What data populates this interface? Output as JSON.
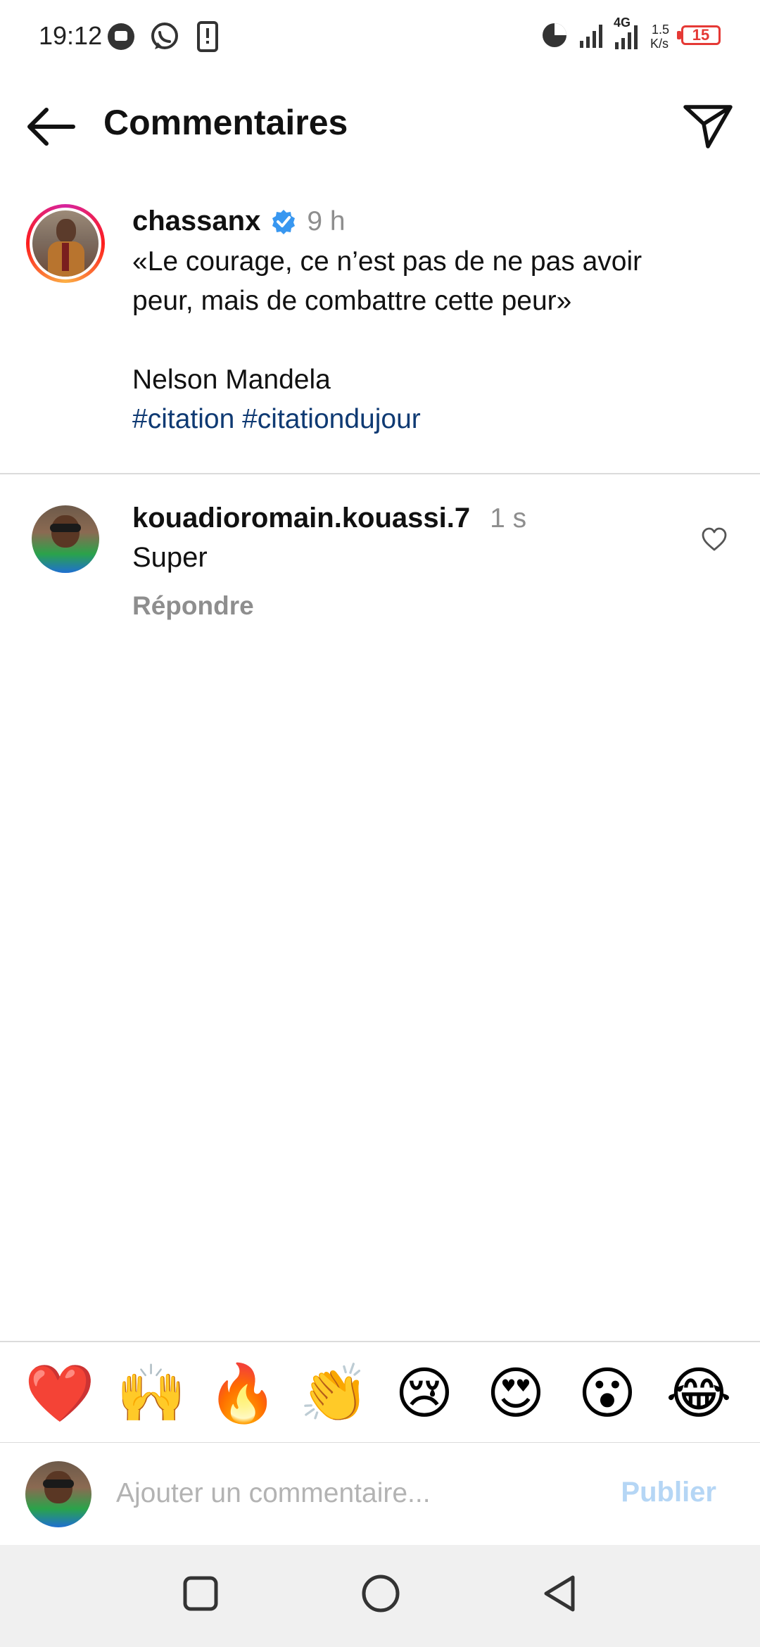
{
  "status_bar": {
    "time": "19:12",
    "network": "4G",
    "speed_top": "1.5",
    "speed_bottom": "K/s",
    "battery": "15"
  },
  "header": {
    "title": "Commentaires",
    "back_icon": "arrow-left-icon",
    "share_icon": "paper-plane-icon"
  },
  "post": {
    "username": "chassanx",
    "verified": true,
    "time": "9 h",
    "caption_line1": "«Le courage, ce n’est pas de ne pas avoir",
    "caption_line2": "peur, mais de combattre cette peur»",
    "author_line": "Nelson Mandela",
    "hashtags": "#citation #citationdujour"
  },
  "comments": [
    {
      "username": "kouadioromain.kouassi.7",
      "time": "1 s",
      "text": "Super",
      "reply_label": "Répondre"
    }
  ],
  "reactions": [
    "❤️",
    "🙌",
    "🔥",
    "👏",
    "😢",
    "😍",
    "😮",
    "😂"
  ],
  "composer": {
    "placeholder": "Ajouter un commentaire...",
    "publish_label": "Publier"
  },
  "colors": {
    "hashtag": "#0f3a73",
    "verified": "#3897f0",
    "publish_disabled": "#b5d6f5",
    "secondary_text": "#8e8e8e"
  }
}
